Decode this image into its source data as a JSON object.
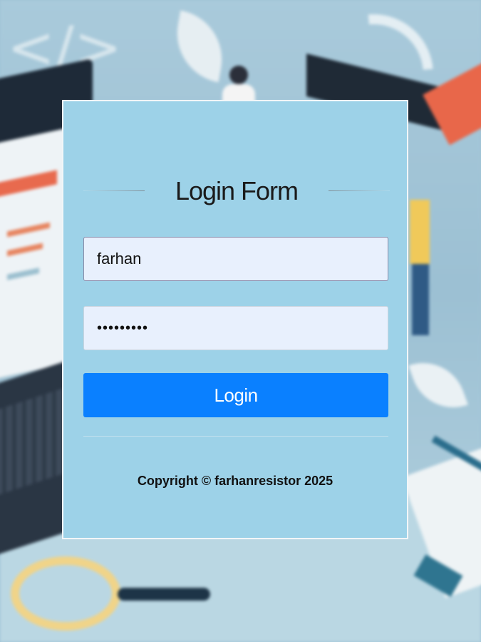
{
  "login": {
    "title": "Login Form",
    "username": {
      "value": "farhan"
    },
    "password": {
      "value": "•••••••••"
    },
    "submit_label": "Login",
    "copyright": "Copyright © farhanresistor 2025"
  },
  "background": {
    "code_symbol": "</>"
  },
  "colors": {
    "card_background": "#9dd2e8",
    "button_primary": "#0a80ff",
    "input_background": "#e8f0fd"
  }
}
